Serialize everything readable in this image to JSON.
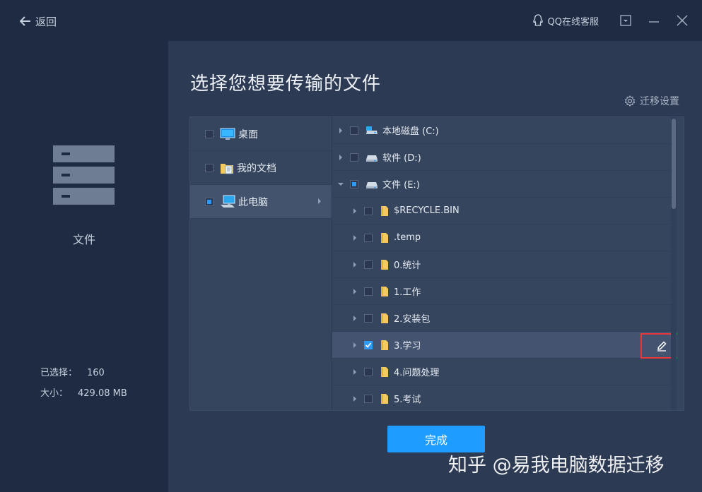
{
  "topbar": {
    "back_label": "返回",
    "qq_label": "QQ在线客服"
  },
  "left": {
    "label": "文件",
    "selected_label": "已选择：",
    "selected_value": "160",
    "size_label": "大小：",
    "size_value": "429.08 MB"
  },
  "main": {
    "title": "选择您想要传输的文件",
    "settings_label": "迁移设置"
  },
  "categories": [
    {
      "label": "桌面",
      "state": "unchecked",
      "icon": "desktop-icon"
    },
    {
      "label": "我的文档",
      "state": "unchecked",
      "icon": "documents-folder-icon"
    },
    {
      "label": "此电脑",
      "state": "partial",
      "icon": "computer-icon",
      "selected": true
    }
  ],
  "tree": [
    {
      "label": "本地磁盘 (C:)",
      "depth": 0,
      "state": "unchecked",
      "icon": "system-drive-icon",
      "expanded": false
    },
    {
      "label": "软件 (D:)",
      "depth": 0,
      "state": "unchecked",
      "icon": "drive-icon",
      "expanded": false
    },
    {
      "label": "文件 (E:)",
      "depth": 0,
      "state": "partial",
      "icon": "drive-icon",
      "expanded": true
    },
    {
      "label": "$RECYCLE.BIN",
      "depth": 1,
      "state": "unchecked",
      "icon": "folder-icon",
      "expanded": false
    },
    {
      "label": ".temp",
      "depth": 1,
      "state": "unchecked",
      "icon": "folder-icon",
      "expanded": false
    },
    {
      "label": "0.统计",
      "depth": 1,
      "state": "unchecked",
      "icon": "folder-icon",
      "expanded": false
    },
    {
      "label": "1.工作",
      "depth": 1,
      "state": "unchecked",
      "icon": "folder-icon",
      "expanded": false
    },
    {
      "label": "2.安装包",
      "depth": 1,
      "state": "unchecked",
      "icon": "folder-icon",
      "expanded": false
    },
    {
      "label": "3.学习",
      "depth": 1,
      "state": "checked",
      "icon": "folder-icon",
      "expanded": false,
      "highlighted": true,
      "edit": true
    },
    {
      "label": "4.问题处理",
      "depth": 1,
      "state": "unchecked",
      "icon": "folder-icon",
      "expanded": false
    },
    {
      "label": "5.考试",
      "depth": 1,
      "state": "unchecked",
      "icon": "folder-icon",
      "expanded": false
    }
  ],
  "done_label": "完成",
  "watermark": "知乎 @易我电脑数据迁移",
  "colors": {
    "accent": "#1f9cff",
    "highlight_border": "#e8373a",
    "folder": "#f4c95d"
  }
}
